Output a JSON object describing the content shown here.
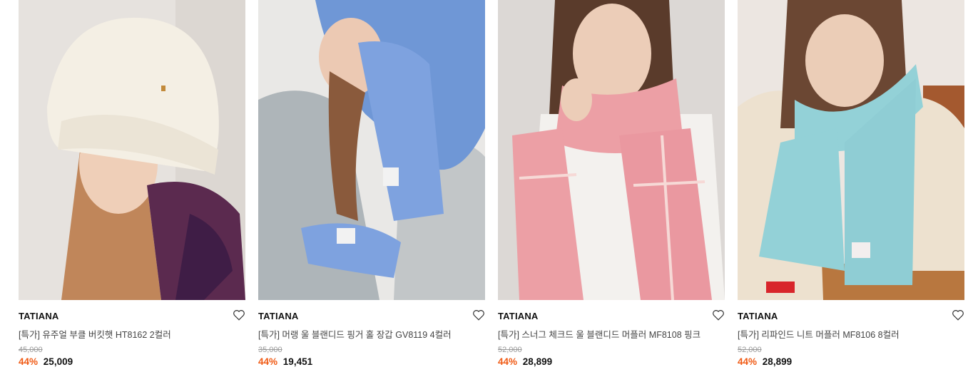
{
  "products": [
    {
      "brand": "TATIANA",
      "name": "[특가] 유주얼 부클 버킷햇 HT8162 2컬러",
      "original_price": "45,000",
      "discount": "44%",
      "price": "25,009",
      "image": "woman-in-cream-boucle-bucket-hat"
    },
    {
      "brand": "TATIANA",
      "name": "[특가] 머랭 울 블랜디드 핑거 홀 장갑 GV8119 4컬러",
      "original_price": "35,000",
      "discount": "44%",
      "price": "19,451",
      "image": "woman-in-blue-hood-and-gloves"
    },
    {
      "brand": "TATIANA",
      "name": "[특가] 스너그 체크드 울 블랜디드 머플러 MF8108 핑크",
      "original_price": "52,000",
      "discount": "44%",
      "price": "28,899",
      "image": "woman-in-pink-check-scarf"
    },
    {
      "brand": "TATIANA",
      "name": "[특가] 리파인드 니트 머플러 MF8106 8컬러",
      "original_price": "52,000",
      "discount": "44%",
      "price": "28,899",
      "image": "woman-in-mint-knit-scarf"
    }
  ],
  "colors": {
    "discount": "#f05a14",
    "text": "#111111",
    "muted": "#999999"
  }
}
